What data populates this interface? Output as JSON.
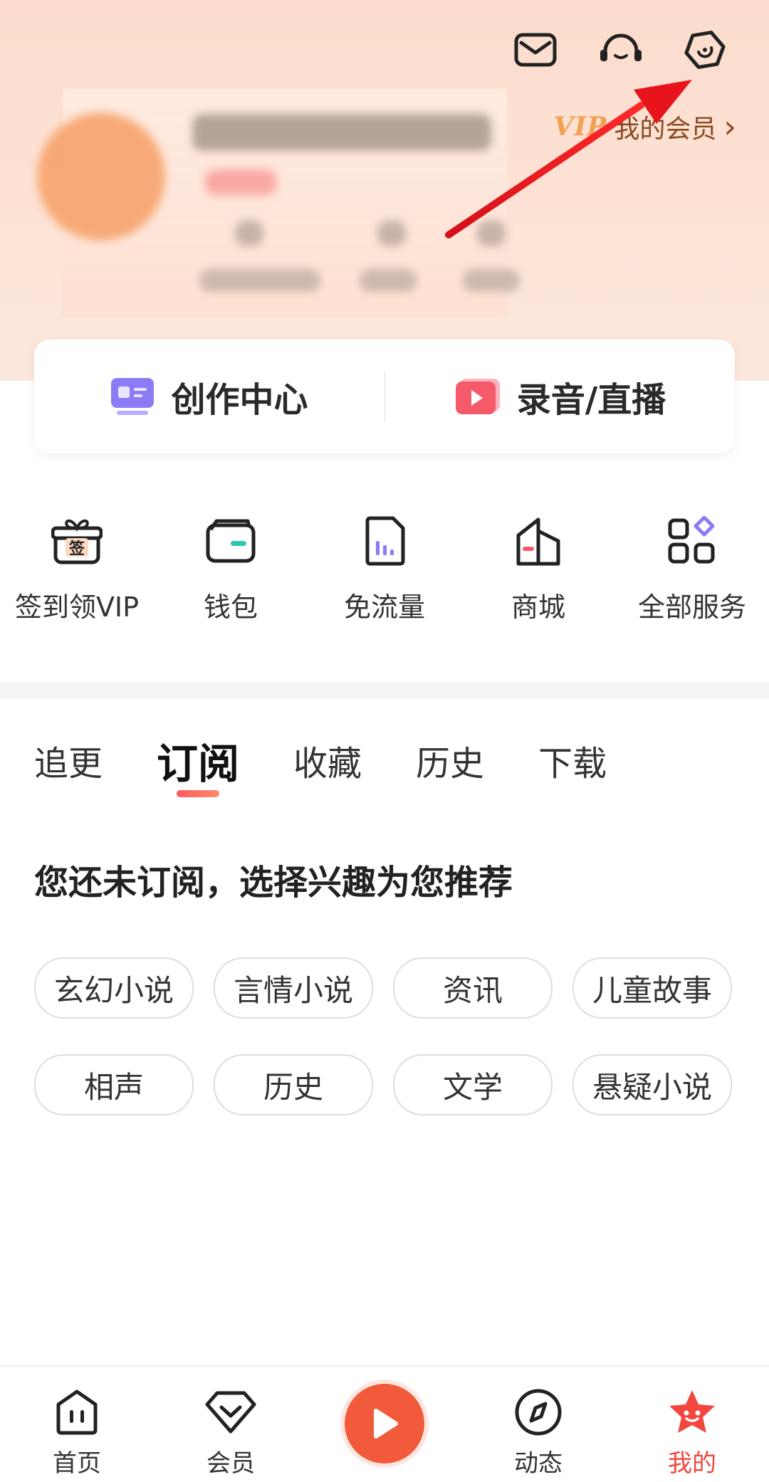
{
  "header": {
    "vip_mark": "VIP",
    "vip_text": "我的会员",
    "vip_chevron": "›",
    "icons": [
      "mail-icon",
      "headset-icon",
      "settings-icon"
    ]
  },
  "create": {
    "creator_center": "创作中心",
    "record_live": "录音/直播"
  },
  "quick": {
    "items": [
      {
        "label": "签到领VIP",
        "icon": "checkin-gift-icon",
        "glyph": "签"
      },
      {
        "label": "钱包",
        "icon": "wallet-icon"
      },
      {
        "label": "免流量",
        "icon": "free-data-icon"
      },
      {
        "label": "商城",
        "icon": "store-icon"
      },
      {
        "label": "全部服务",
        "icon": "all-services-icon"
      }
    ]
  },
  "tabs": {
    "items": [
      "追更",
      "订阅",
      "收藏",
      "历史",
      "下载"
    ],
    "active": "订阅"
  },
  "empty": {
    "title": "您还未订阅，选择兴趣为您推荐"
  },
  "chips": [
    "玄幻小说",
    "言情小说",
    "资讯",
    "儿童故事",
    "相声",
    "历史",
    "文学",
    "悬疑小说"
  ],
  "tabbar": {
    "items": [
      {
        "label": "首页",
        "icon": "home-icon"
      },
      {
        "label": "会员",
        "icon": "member-icon"
      },
      {
        "label": "",
        "icon": "play-icon"
      },
      {
        "label": "动态",
        "icon": "compass-icon"
      },
      {
        "label": "我的",
        "icon": "mine-icon"
      }
    ],
    "active": "我的"
  },
  "colors": {
    "accent": "#f15a3a",
    "active_tab": "#f2463f",
    "header_bg": "#fde3d5",
    "vip_gold": "#f2a052"
  }
}
